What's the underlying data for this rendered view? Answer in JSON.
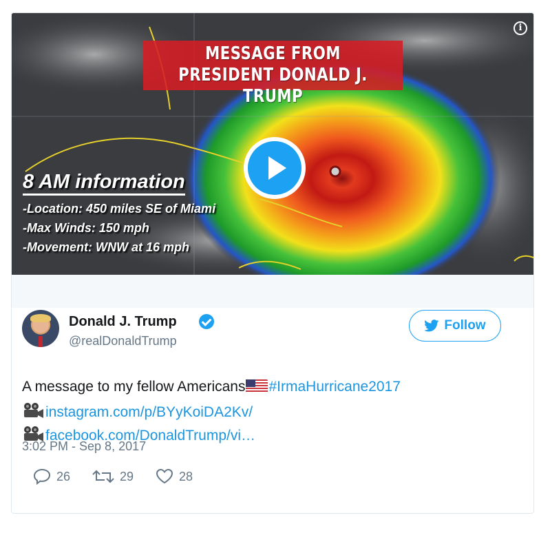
{
  "media": {
    "banner_line1": "MESSAGE FROM",
    "banner_line2": "PRESIDENT DONALD J. TRUMP",
    "info_heading": "8 AM information",
    "info_lines": [
      "-Location: 450 miles SE of Miami",
      "-Max Winds: 150 mph",
      "-Movement: WNW at 16 mph"
    ],
    "icons": {
      "info": "info-icon",
      "play": "play-icon"
    }
  },
  "tweet": {
    "display_name": "Donald J. Trump",
    "handle": "@realDonaldTrump",
    "follow_label": "Follow",
    "text_line1": "A message to my fellow Americans",
    "hashtag": "#IrmaHurricane2017",
    "link1": "instagram.com/p/BYyKoiDA2Kv/",
    "link2": "facebook.com/DonaldTrump/vi…",
    "timestamp": "3:02 PM - Sep 8, 2017",
    "replies": "26",
    "retweets": "29",
    "likes": "28"
  },
  "colors": {
    "accent": "#1da1f2",
    "link": "#1b95e0",
    "muted": "#657786",
    "text": "#14171a",
    "banner_red": "#d61e24"
  }
}
